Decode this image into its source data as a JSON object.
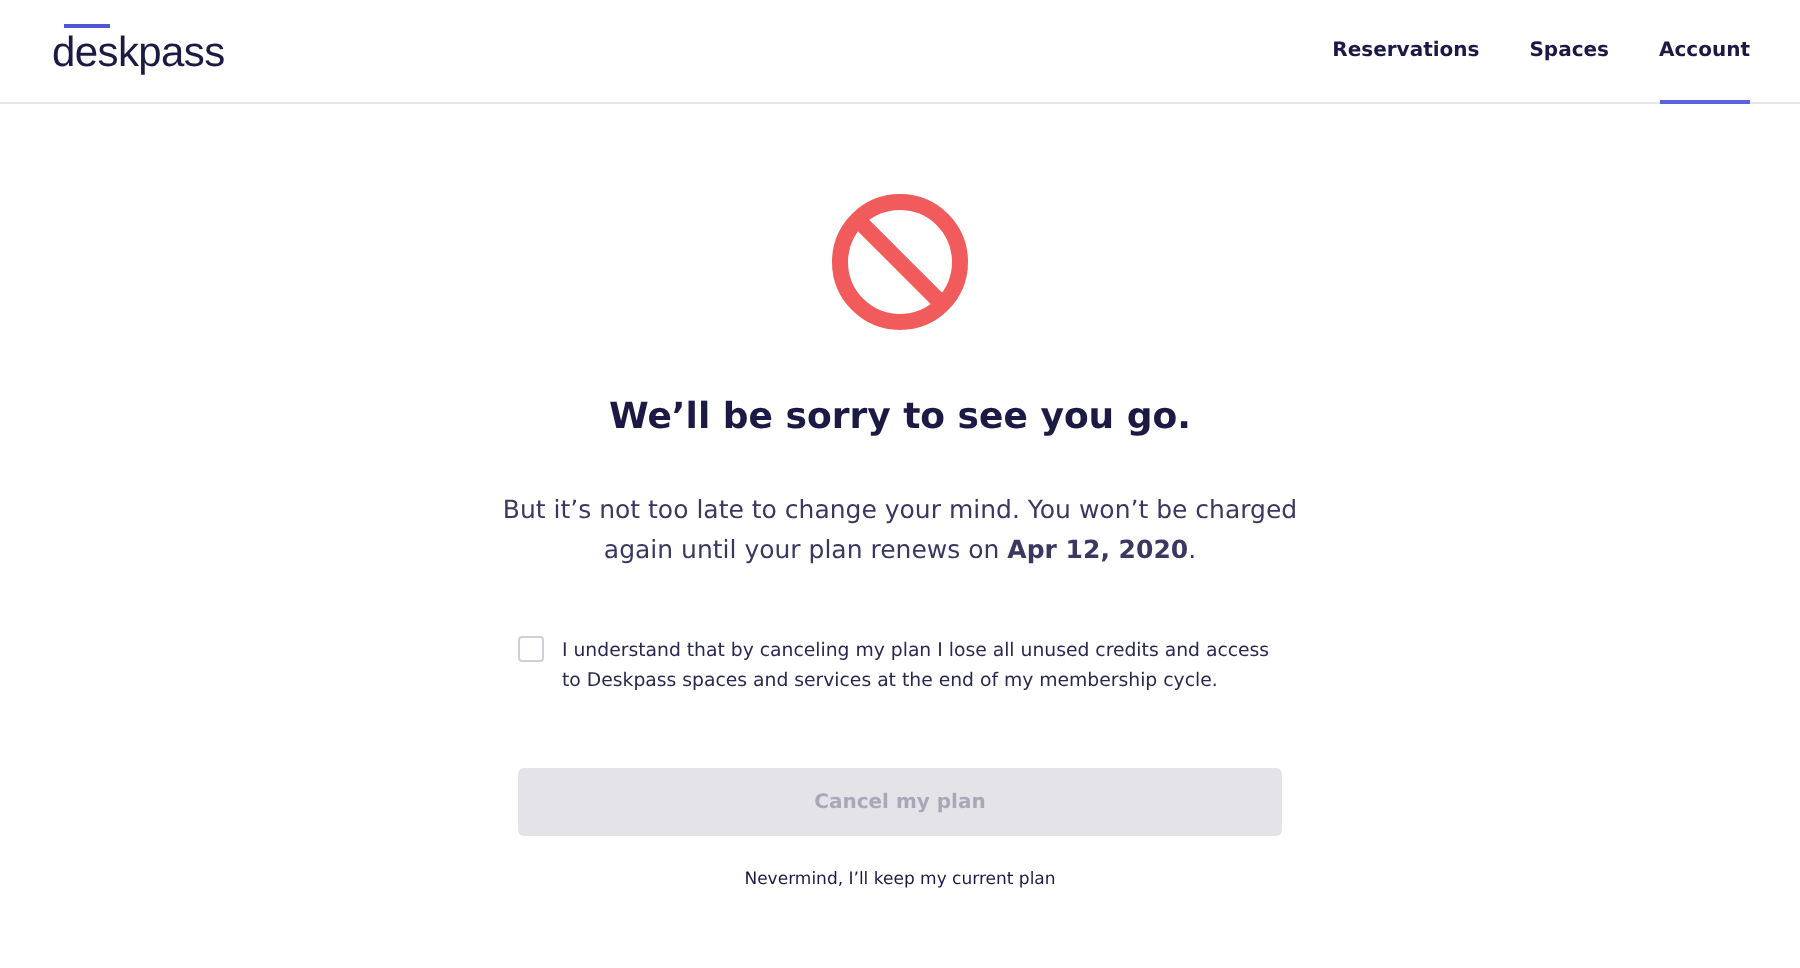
{
  "logo": "deskpass",
  "nav": [
    {
      "label": "Reservations",
      "selected": false
    },
    {
      "label": "Spaces",
      "selected": false
    },
    {
      "label": "Account",
      "selected": true
    }
  ],
  "heading": "We’ll be sorry to see you go.",
  "message": "But it’s not too late to change your mind. You won’t be charged again until your plan renews on **Apr 12, 2020**.",
  "consent": {
    "label": "I understand that by canceling my plan I lose all unused credits and access to Deskpass spaces and services at the end of my membership cycle.",
    "checked": false
  },
  "cancel_button": {
    "label": "Cancel my plan",
    "disabled": true
  },
  "keep_link": "Nevermind, I’ll keep my current plan"
}
